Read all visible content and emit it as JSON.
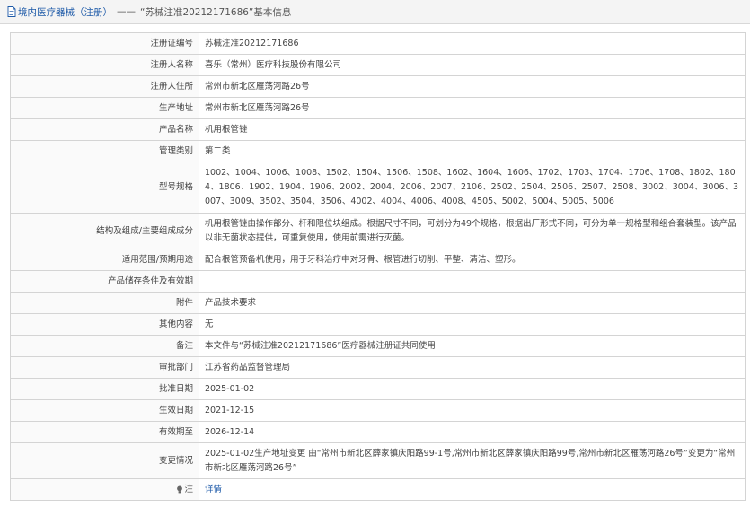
{
  "header": {
    "title": "境内医疗器械（注册）",
    "arrow": "——",
    "crumb": "“苏械注准20212171686”基本信息"
  },
  "rows": [
    {
      "label": "注册证编号",
      "value": "苏械注准20212171686"
    },
    {
      "label": "注册人名称",
      "value": "喜乐（常州）医疗科技股份有限公司"
    },
    {
      "label": "注册人住所",
      "value": "常州市新北区雁荡河路26号"
    },
    {
      "label": "生产地址",
      "value": "常州市新北区雁荡河路26号"
    },
    {
      "label": "产品名称",
      "value": "机用根管锉"
    },
    {
      "label": "管理类别",
      "value": "第二类"
    },
    {
      "label": "型号规格",
      "value": "1002、1004、1006、1008、1502、1504、1506、1508、1602、1604、1606、1702、1703、1704、1706、1708、1802、1804、1806、1902、1904、1906、2002、2004、2006、2007、2106、2502、2504、2506、2507、2508、3002、3004、3006、3007、3009、3502、3504、3506、4002、4004、4006、4008、4505、5002、5004、5005、5006"
    },
    {
      "label": "结构及组成/主要组成成分",
      "value": "机用根管锉由操作部分、杆和限位块组成。根据尺寸不同，可划分为49个规格，根据出厂形式不同，可分为单一规格型和组合套装型。该产品以非无菌状态提供，可重复使用，使用前需进行灭菌。"
    },
    {
      "label": "适用范围/预期用途",
      "value": "配合根管预备机使用，用于牙科治疗中对牙骨、根管进行切削、平整、清洁、塑形。"
    },
    {
      "label": "产品储存条件及有效期",
      "value": ""
    },
    {
      "label": "附件",
      "value": "产品技术要求"
    },
    {
      "label": "其他内容",
      "value": "无"
    },
    {
      "label": "备注",
      "value": "本文件与“苏械注准20212171686”医疗器械注册证共同使用"
    },
    {
      "label": "审批部门",
      "value": "江苏省药品监督管理局"
    },
    {
      "label": "批准日期",
      "value": "2025-01-02"
    },
    {
      "label": "生效日期",
      "value": "2021-12-15"
    },
    {
      "label": "有效期至",
      "value": "2026-12-14"
    },
    {
      "label": "变更情况",
      "value": "2025-01-02生产地址变更 由“常州市新北区薛家镇庆阳路99-1号,常州市新北区薛家镇庆阳路99号,常州市新北区雁荡河路26号”变更为“常州市新北区雁荡河路26号”"
    }
  ],
  "note_row": {
    "label": "注",
    "link": "详情"
  },
  "icons": {
    "header": "document-icon",
    "note": "lightbulb-icon"
  },
  "colors": {
    "link": "#1e5aa8",
    "border": "#d4d4d4",
    "header_bg": "#f4f4f4"
  }
}
